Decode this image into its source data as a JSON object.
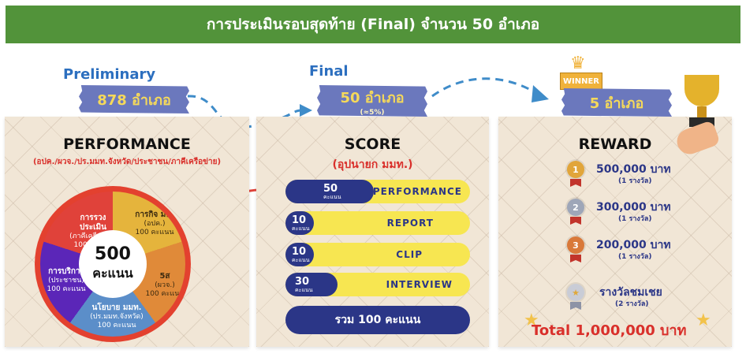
{
  "header": {
    "title": "การประเมินรอบสุดท้าย (Final) จำนวน 50 อำเภอ"
  },
  "preliminary": {
    "stage_label": "Preliminary",
    "count": "878 อำเภอ",
    "title": "PERFORMANCE",
    "subtitle": "(อปค./ผวจ./ปร.มมท.จังหวัด/ประชาชน/ภาคีเครือข่าย)",
    "wheel": {
      "total": "500",
      "unit": "คะแนน",
      "segments": [
        {
          "title": "การรวงประเมิน",
          "line1": "(ภาคีเครือข่าย)",
          "score": "100 คะแนน"
        },
        {
          "title": "การกิจ มท.",
          "line1": "(อปค.)",
          "score": "100 คะแนน"
        },
        {
          "title": "5ส",
          "line1": "(ผวจ.)",
          "score": "100 คะแนน"
        },
        {
          "title": "นโยบาย มมท.",
          "line1": "(ปร.มมท.จังหวัด)",
          "score": "100 คะแนน"
        },
        {
          "title": "การบริการ",
          "line1": "(ประชาชน)",
          "score": "100 คะแนน"
        }
      ]
    }
  },
  "final": {
    "stage_label": "Final",
    "count": "50 อำเภอ",
    "percent": "(≈5%)",
    "title": "SCORE",
    "subtitle": "(อุปนายก มมท.)",
    "items": [
      {
        "score": "50",
        "unit": "คะแนน",
        "label": "PERFORMANCE"
      },
      {
        "score": "10",
        "unit": "คะแนน",
        "label": "REPORT"
      },
      {
        "score": "10",
        "unit": "คะแนน",
        "label": "CLIP"
      },
      {
        "score": "30",
        "unit": "คะแนน",
        "label": "INTERVIEW"
      }
    ],
    "total": "รวม 100 คะแนน"
  },
  "reward": {
    "winner_badge": "WINNER",
    "count": "5 อำเภอ",
    "title": "REWARD",
    "prizes": [
      {
        "medal": "1",
        "amount": "500,000 บาท",
        "count": "(1 รางวัล)"
      },
      {
        "medal": "2",
        "amount": "300,000 บาท",
        "count": "(1 รางวัล)"
      },
      {
        "medal": "3",
        "amount": "200,000 บาท",
        "count": "(1 รางวัล)"
      },
      {
        "medal": "★",
        "amount": "รางวัลชมเชย",
        "count": "(2 รางวัล)"
      }
    ],
    "total": "Total 1,000,000 บาท"
  },
  "colors": {
    "header_bg": "#52933a",
    "tape": "#6b78bd",
    "navy": "#2b3687",
    "yellow": "#f7e651",
    "red": "#d9302b",
    "stage_blue": "#2c6fbf"
  }
}
